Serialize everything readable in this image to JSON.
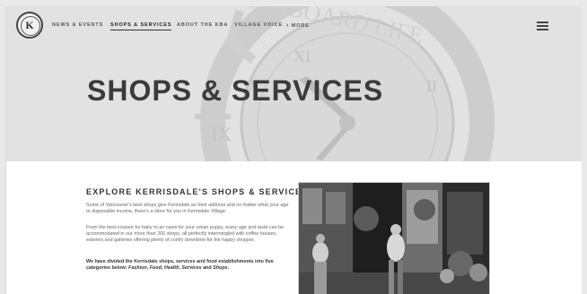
{
  "nav": {
    "items": [
      "NEWS & EVENTS",
      "SHOPS & SERVICES",
      "ABOUT THE KBA",
      "VILLAGE VOICE",
      "MORE"
    ],
    "active": "SHOPS & SERVICES"
  },
  "logo": {
    "letter": "K"
  },
  "hero": {
    "title": "SHOPS & SERVICES",
    "watermark": "SEABOARD LIFE"
  },
  "section": {
    "title": "EXPLORE KERRISDALE'S SHOPS & SERVICES",
    "p1": "Some of Vancouver's best shops give Kerrisdale as their address and no matter what your age or disposable income, there's a store for you in Kerrisdale Village.",
    "p2_pre": "From the best couture for baby to an oasis for your urban puppy,",
    "p2_em": "every",
    "p2_mid": "age and taste can be accommodated in our more than 200 shops, all perfectly intermingled with coffee houses, eateries and galleries offering plenty of comfy downtime for the happy shopper.",
    "p3_pre": "We have divided the Kerrisdale shops, services and food establishments into five categories below:",
    "categories": [
      "Fashion",
      "Food",
      "Health",
      "Services",
      "Shops"
    ],
    "p3_and": "and"
  },
  "colors": {
    "hero_bg": "#e2e2e2",
    "title": "#3b3b3b",
    "text": "#666666"
  }
}
